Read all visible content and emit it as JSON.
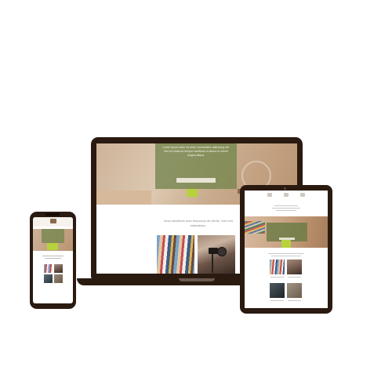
{
  "scene": "responsive-mockup",
  "colors": {
    "device_frame": "#2a1a10",
    "accent_green": "#b7d23c",
    "hero_overlay": "#788750"
  },
  "laptop": {
    "hero_text": "Lorem ipsum dolor sit amet, consectetur adipiscing elit. Sed do eiusmod tempor incididunt ut labore et dolore magna aliqua.",
    "hero_button": "",
    "intro_text": "Nous travaillons avec beaucoup de clients. Voici nos réalisations."
  },
  "phone": {},
  "tablet": {
    "nav_labels": [
      "",
      "",
      ""
    ],
    "hero_text": ""
  }
}
